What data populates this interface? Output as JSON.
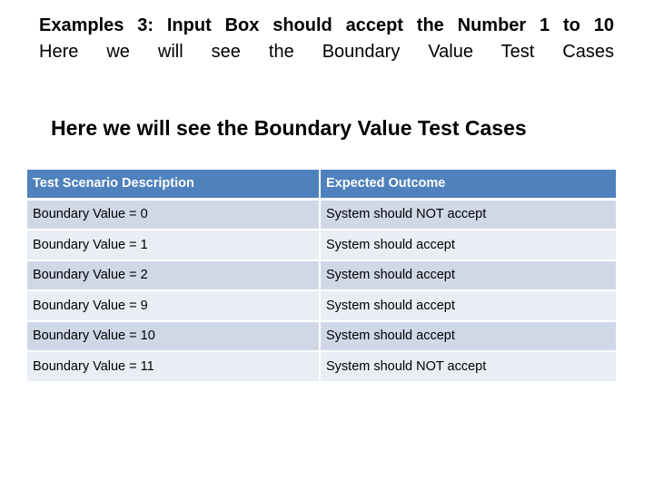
{
  "heading": {
    "line1": "Examples 3: Input Box should accept the Number 1 to 10",
    "line2": "Here we will see the Boundary Value Test Cases"
  },
  "subheading": "Here we will see the Boundary Value Test Cases",
  "table": {
    "headers": [
      "Test Scenario Description",
      "Expected Outcome"
    ],
    "rows": [
      [
        "Boundary Value = 0",
        "System should NOT accept"
      ],
      [
        "Boundary Value = 1",
        "System should accept"
      ],
      [
        "Boundary Value = 2",
        "System should accept"
      ],
      [
        "Boundary Value = 9",
        "System should accept"
      ],
      [
        "Boundary Value = 10",
        "System should accept"
      ],
      [
        "Boundary Value = 11",
        "System should NOT accept"
      ]
    ]
  },
  "colors": {
    "header_bg": "#4f81bd",
    "row_odd_bg": "#d0d8e8",
    "row_even_bg": "#e9edf4"
  }
}
